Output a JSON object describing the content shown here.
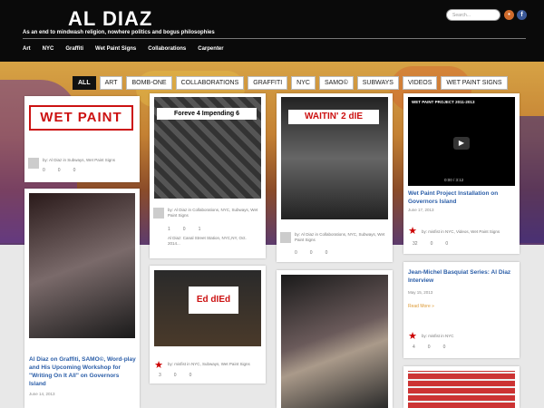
{
  "header": {
    "title": "AL DIAZ",
    "tagline": "As an end to mindwash religion, nowhere politics and bogus philosophies",
    "search_placeholder": "Search...",
    "rss_icon": "rss-icon",
    "facebook_icon": "facebook-icon"
  },
  "nav": [
    "Art",
    "NYC",
    "Graffiti",
    "Wet Paint Signs",
    "Collaborations",
    "Carpenter"
  ],
  "filters": [
    "ALL",
    "ART",
    "BOMB-ONE",
    "COLLABORATIONS",
    "GRAFFITI",
    "NYC",
    "SAMO©",
    "SUBWAYS",
    "VIDEOS",
    "WET PAINT SIGNS"
  ],
  "cards": {
    "c1": {
      "sign": "WET PAINT",
      "meta": "by: Al Diaz in Subways, Wet Paint Signs",
      "counts": [
        "0",
        "0",
        "0"
      ]
    },
    "c2": {
      "sign": "Foreve 4 Impending 6",
      "meta": "by: Al Diaz in Collaborations, NYC, Subways, Wet Paint Signs",
      "counts": [
        "1",
        "0",
        "1"
      ],
      "caption": "Al Diaz: Canal Street Station, NYC,NY, Oct. 2014..."
    },
    "c3": {
      "sign": "WAITIN' 2 dIE",
      "meta": "by: Al Diaz in Collaborations, NYC, Subways, Wet Paint Signs",
      "counts": [
        "0",
        "0",
        "0"
      ]
    },
    "c4": {
      "video_title": "WET PAINT PROJECT 2011-2013",
      "time": "0:00 / 3:12",
      "title": "Wet Paint Project Installation on Governors Island",
      "date": "June 17, 2013",
      "meta": "by: misfist in NYC, Videos, Wet Paint Signs",
      "counts": [
        "32",
        "0",
        "0"
      ]
    },
    "c5": {
      "title": "Al Diaz on Graffiti, SAMO©, Word-play and His Upcoming Workshop for \"Writing On It All\" on Governors Island",
      "date": "June 14, 2013"
    },
    "c6": {
      "sign": "Ed dIEd",
      "meta": "by: misfist in NYC, Subways, Wet Paint Signs",
      "counts": [
        "3",
        "0",
        "0"
      ]
    },
    "c7": {
      "title": "Jean-Michel Basquiat Series: Al Diaz Interview",
      "date": "May 15, 2013",
      "read_more": "Read More »",
      "meta": "by: misfist in NYC",
      "counts": [
        "4",
        "0",
        "0"
      ]
    }
  }
}
